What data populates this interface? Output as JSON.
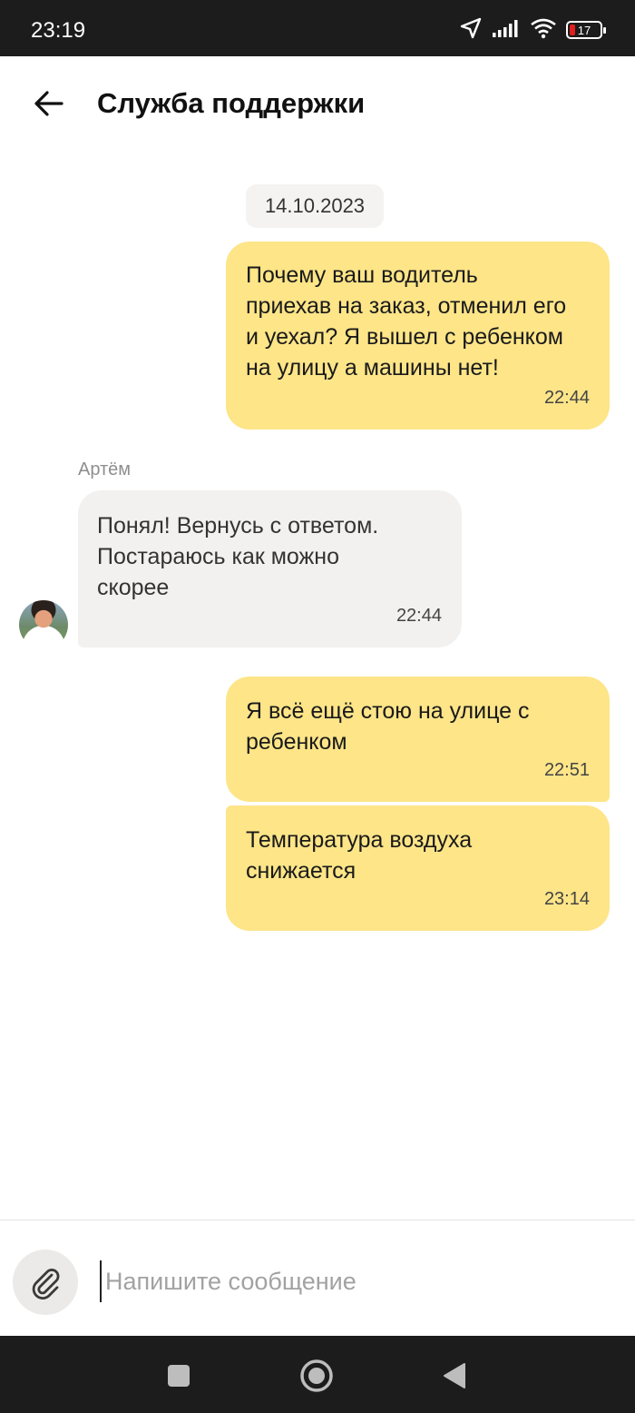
{
  "status_bar": {
    "time": "23:19",
    "battery_level": "17",
    "icons": [
      "location-arrow-icon",
      "signal-icon",
      "wifi-icon",
      "battery-icon"
    ]
  },
  "header": {
    "title": "Служба поддержки",
    "back_icon": "arrow-left-icon"
  },
  "chat": {
    "date": "14.10.2023",
    "messages": [
      {
        "direction": "outgoing",
        "text": "Почему ваш водитель\nприехав на заказ, отменил его\nи уехал? Я вышел с ребенком\nна улицу а машины нет!",
        "time": "22:44"
      },
      {
        "direction": "incoming",
        "sender": "Артём",
        "text": "Понял! Вернусь с ответом.\nПостараюсь как можно\nскорее",
        "time": "22:44"
      },
      {
        "direction": "outgoing",
        "text": "Я всё ещё стою на улице с\nребенком",
        "time": "22:51"
      },
      {
        "direction": "outgoing",
        "text": "Температура воздуха\nснижается",
        "time": "23:14"
      }
    ]
  },
  "composer": {
    "placeholder": "Напишите сообщение",
    "value": "",
    "attach_icon": "paperclip-icon"
  },
  "nav_bar": {
    "buttons": [
      "square-recents-icon",
      "circle-home-icon",
      "triangle-back-icon"
    ]
  },
  "colors": {
    "outgoing_bubble": "#fde588",
    "incoming_bubble": "#f2f1ef",
    "system_bars": "#1c1c1c"
  }
}
